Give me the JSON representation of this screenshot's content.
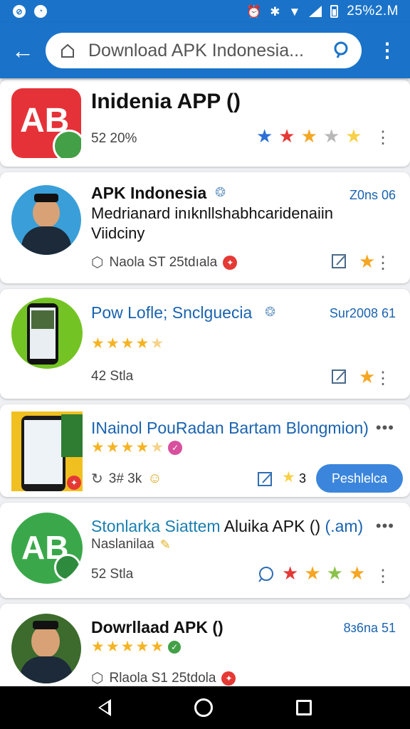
{
  "colors": {
    "primary": "#1a73c9",
    "star_blue": "#2d6fd6",
    "star_red": "#e53935",
    "star_orange": "#f5a623",
    "star_gray": "#b8b8b8",
    "star_yellow": "#f7d046",
    "star_green": "#8bc34a",
    "button": "#3b86dc"
  },
  "status_bar": {
    "left_icons": [
      "wifi-off-icon",
      "clock-icon"
    ],
    "time": "25%2.M"
  },
  "search": {
    "value": "Download APK Indonesia..."
  },
  "apps": [
    {
      "title": "Inidenia APP ()",
      "icon_text": "AB",
      "sub": "52 20%",
      "rating_stars": [
        "blue",
        "red",
        "orange",
        "gray",
        "yellow"
      ]
    },
    {
      "title": "APK Indonesia",
      "meta": "Z0ns 06",
      "desc": "Medrianard inıknllshabhcaridenaiin Viidciny",
      "sub": "Naola ST 25tdıala"
    },
    {
      "title": "Pow Lofle; Snclguecia",
      "meta": "Sur2008 61",
      "sub": "42 Stla",
      "rating": 4.5
    },
    {
      "title": "INainol PouRadan Bartam Blongmion)",
      "sub": "3# 3k",
      "rating": 4.5,
      "count": "3",
      "install_label": "Peshlelca"
    },
    {
      "title_part1": "Stonlarka Siattem",
      "title_part2": "Aluika APK ()",
      "title_part3": "(.am)",
      "icon_text": "AB",
      "desc": "Naslanilaa",
      "sub": "52 Stla",
      "rating_stars": [
        "red",
        "orange",
        "green",
        "orange"
      ]
    },
    {
      "title": "Dowrllaad APK ()",
      "meta": "8з6nа 51",
      "sub": "Rlaola S1 25tdola",
      "rating": 5
    }
  ]
}
